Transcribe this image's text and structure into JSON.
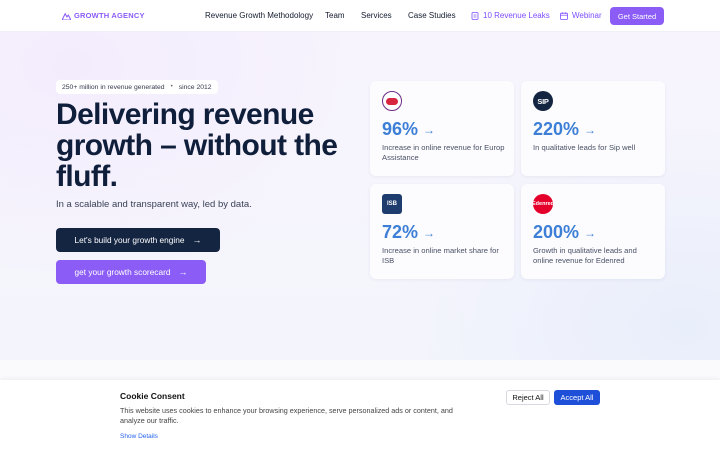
{
  "nav": {
    "logo_text": "GROWTH AGENCY",
    "links": [
      "Revenue Growth Methodology",
      "Team",
      "Services",
      "Case Studies"
    ],
    "leaks_label": "10 Revenue Leaks",
    "webinar_label": "Webinar",
    "cta_label": "Get Started"
  },
  "hero": {
    "badge_text": "250+ million in revenue generated",
    "badge_since": "since 2012",
    "badge_sep": "•",
    "headline": "Delivering revenue growth – without the fluff.",
    "subtext": "In a scalable and transparent way, led by data.",
    "primary_button": "Let's build your growth engine",
    "secondary_button": "get your growth scorecard",
    "arrow": "→"
  },
  "cards": [
    {
      "logo": "europ-assistance-logo",
      "logo_text": "",
      "value": "96%",
      "desc": "Increase in online revenue for Europ Assistance"
    },
    {
      "logo": "sip-logo",
      "logo_text": "SIP",
      "value": "220%",
      "desc": "In qualitative leads for Sip well"
    },
    {
      "logo": "isb-logo",
      "logo_text": "ISB",
      "value": "72%",
      "desc": "Increase in online market share for ISB"
    },
    {
      "logo": "edenred-logo",
      "logo_text": "Edenred",
      "value": "200%",
      "desc": "Growth in qualitative leads and online revenue for Edenred"
    }
  ],
  "cookie": {
    "title": "Cookie Consent",
    "text": "This website uses cookies to enhance your browsing experience, serve personalized ads or content, and analyze our traffic.",
    "details_link": "Show Details",
    "reject_label": "Reject All",
    "accept_label": "Accept All"
  },
  "colors": {
    "brand_purple": "#8b5cf6",
    "navy": "#142542",
    "stat_blue": "#3d7fd6",
    "accept_blue": "#1d4fd8"
  }
}
